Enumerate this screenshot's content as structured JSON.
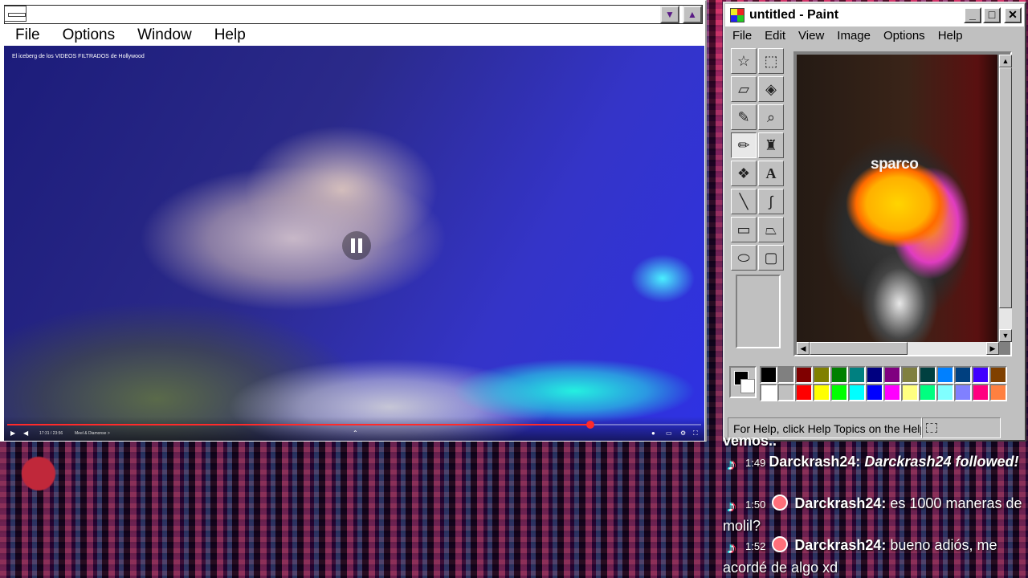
{
  "player": {
    "menu": [
      "File",
      "Options",
      "Window",
      "Help"
    ],
    "video_title": "El iceberg de los VIDEOS FILTRADOS de Hollywood",
    "time": "17:31 / 23:56",
    "chapter": "Meel & Diamonse >",
    "progress_fraction": 0.84
  },
  "paint": {
    "title": "untitled - Paint",
    "menu": [
      "File",
      "Edit",
      "View",
      "Image",
      "Options",
      "Help"
    ],
    "canvas_text": "sparco",
    "status": "For Help, click Help Topics on the Help Menu.",
    "palette_top": [
      "#000000",
      "#808080",
      "#800000",
      "#808000",
      "#008000",
      "#008080",
      "#000080",
      "#800080",
      "#808040",
      "#004040",
      "#0080ff",
      "#004080",
      "#4000ff",
      "#804000"
    ],
    "palette_bottom": [
      "#ffffff",
      "#c0c0c0",
      "#ff0000",
      "#ffff00",
      "#00ff00",
      "#00ffff",
      "#0000ff",
      "#ff00ff",
      "#ffff80",
      "#00ff80",
      "#80ffff",
      "#8080ff",
      "#ff0080",
      "#ff8040"
    ]
  },
  "chat": {
    "partial": "vemos..",
    "messages": [
      {
        "time": "1:49",
        "user": "Darckrash24:",
        "text": "Darckrash24 followed!",
        "gift": false,
        "italic": true
      },
      {
        "time": "1:50",
        "user": "Darckrash24:",
        "text": "es 1000 maneras de molil?",
        "gift": true,
        "italic": false
      },
      {
        "time": "1:52",
        "user": "Darckrash24:",
        "text": "bueno adiós, me acordé de algo xd",
        "gift": true,
        "italic": false
      }
    ]
  }
}
